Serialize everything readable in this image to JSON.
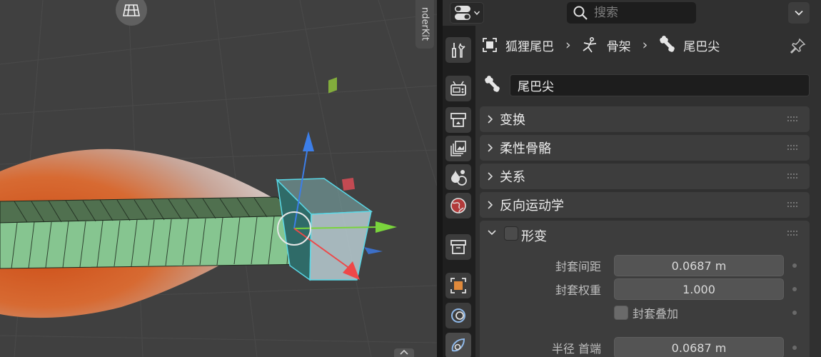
{
  "viewport": {
    "side_tab_label": "nderKit"
  },
  "header": {
    "search_placeholder": "搜索"
  },
  "breadcrumb": {
    "object_name": "狐狸尾巴",
    "armature_name": "骨架",
    "bone_name": "尾巴尖"
  },
  "bone_name_field": "尾巴尖",
  "panels": {
    "transform": "变换",
    "bendy_bones": "柔性骨骼",
    "relations": "关系",
    "inverse_kinematics": "反向运动学",
    "deform": "形变"
  },
  "deform": {
    "envelope_distance_label": "封套间距",
    "envelope_distance_value": "0.0687 m",
    "envelope_weight_label": "封套权重",
    "envelope_weight_value": "1.000",
    "envelope_multiply_label": "封套叠加",
    "radius_head_label": "半径 首端",
    "radius_head_value": "0.0687 m"
  },
  "icons": {
    "editor_type": "properties-editor-icon",
    "search": "search-icon",
    "options": "chevron-down-icon",
    "pin": "pin-icon",
    "tabs": [
      "tool-icon",
      "render-icon",
      "output-icon",
      "view-layer-icon",
      "scene-icon",
      "world-icon",
      "collection-icon",
      "object-icon",
      "modifier-icon",
      "particles-icon"
    ]
  },
  "colors": {
    "panel_bg": "#3d3d3d",
    "field_bg": "#545454",
    "viewport_bg": "#404040",
    "selection_outline": "#59d7e6"
  }
}
